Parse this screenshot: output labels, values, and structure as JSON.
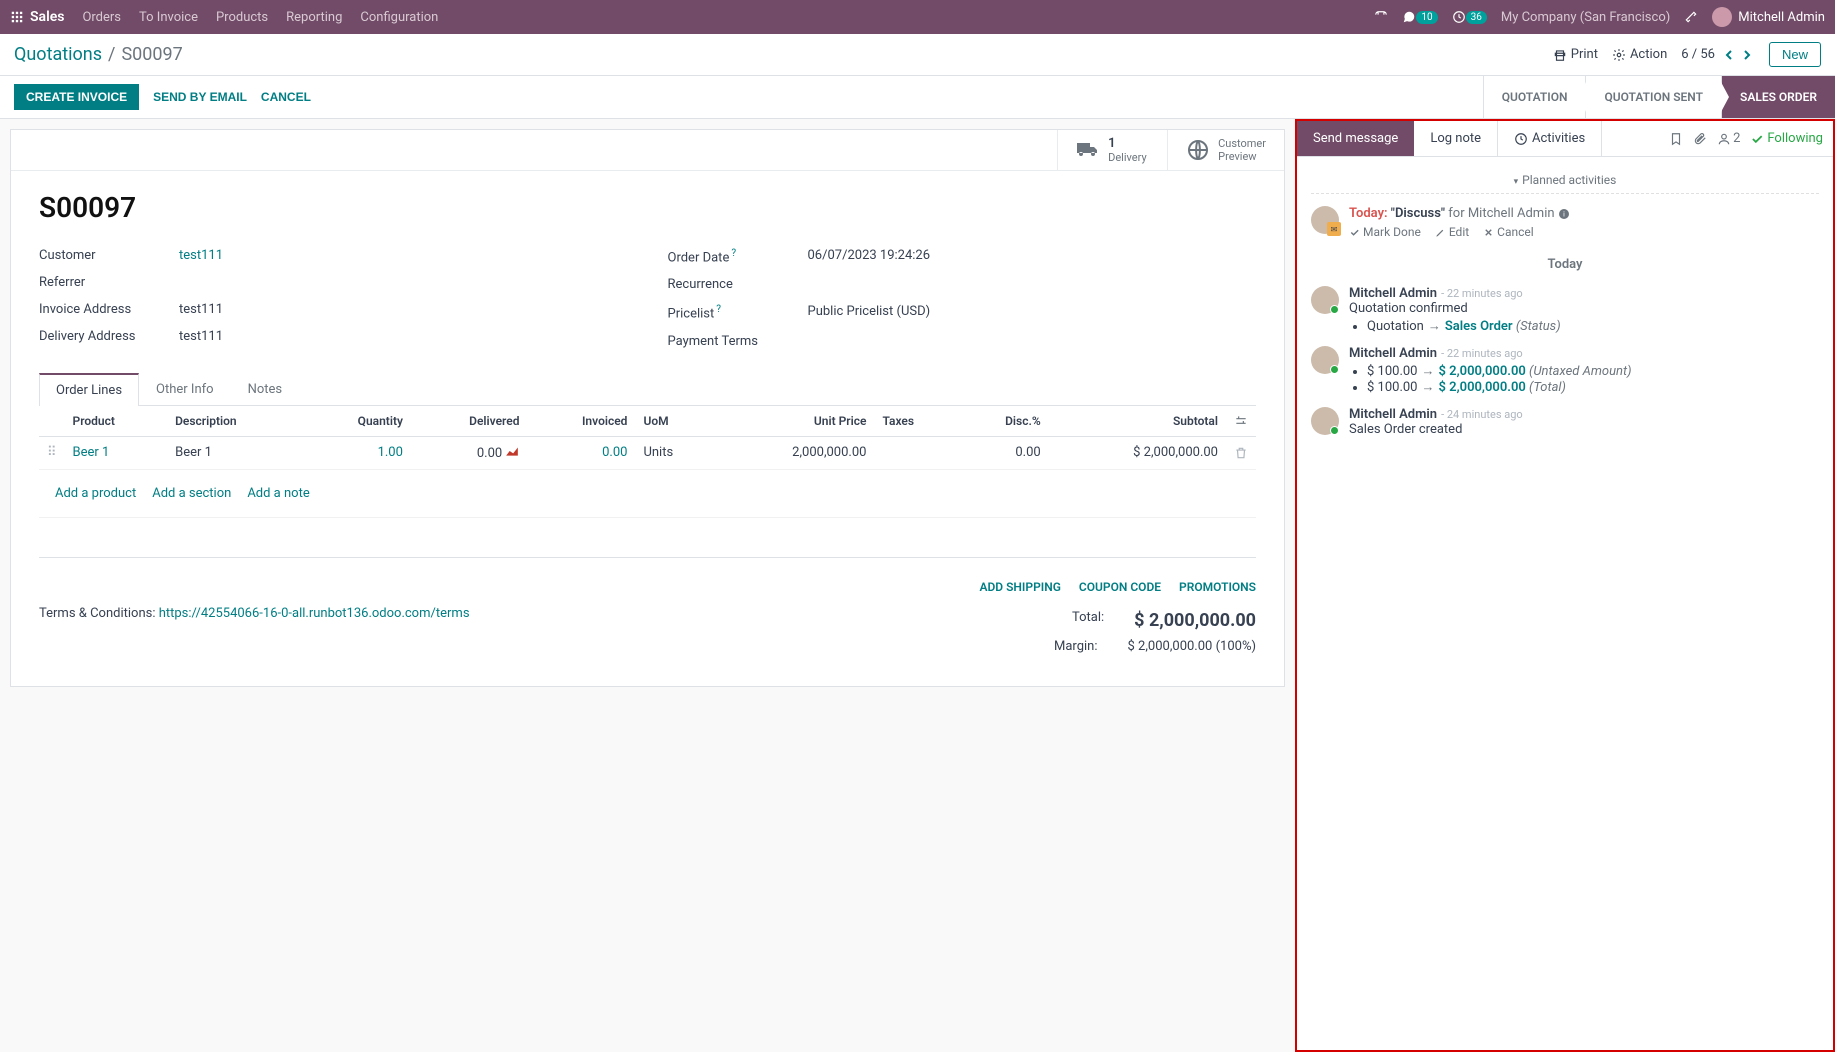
{
  "navbar": {
    "app": "Sales",
    "menus": [
      "Orders",
      "To Invoice",
      "Products",
      "Reporting",
      "Configuration"
    ],
    "messages_badge": "10",
    "activities_badge": "36",
    "company": "My Company (San Francisco)",
    "user": "Mitchell Admin"
  },
  "control_panel": {
    "parent": "Quotations",
    "current": "S00097",
    "print": "Print",
    "action": "Action",
    "pager": "6 / 56",
    "new": "New"
  },
  "action_bar": {
    "create_invoice": "CREATE INVOICE",
    "send_email": "SEND BY EMAIL",
    "cancel": "CANCEL",
    "status": {
      "quotation": "QUOTATION",
      "sent": "QUOTATION SENT",
      "order": "SALES ORDER"
    }
  },
  "stat_buttons": {
    "delivery_count": "1",
    "delivery_label": "Delivery",
    "preview_label": "Customer\nPreview"
  },
  "record": {
    "name": "S00097",
    "customer_label": "Customer",
    "customer": "test111",
    "referrer_label": "Referrer",
    "invoice_addr_label": "Invoice Address",
    "invoice_addr": "test111",
    "delivery_addr_label": "Delivery Address",
    "delivery_addr": "test111",
    "order_date_label": "Order Date",
    "order_date": "06/07/2023 19:24:26",
    "recurrence_label": "Recurrence",
    "pricelist_label": "Pricelist",
    "pricelist": "Public Pricelist (USD)",
    "payment_terms_label": "Payment Terms"
  },
  "tabs": {
    "order_lines": "Order Lines",
    "other_info": "Other Info",
    "notes": "Notes"
  },
  "table": {
    "headers": {
      "product": "Product",
      "description": "Description",
      "quantity": "Quantity",
      "delivered": "Delivered",
      "invoiced": "Invoiced",
      "uom": "UoM",
      "unit_price": "Unit Price",
      "taxes": "Taxes",
      "disc": "Disc.%",
      "subtotal": "Subtotal"
    },
    "rows": [
      {
        "product": "Beer 1",
        "description": "Beer 1",
        "quantity": "1.00",
        "delivered": "0.00",
        "invoiced": "0.00",
        "uom": "Units",
        "unit_price": "2,000,000.00",
        "taxes": "",
        "disc": "0.00",
        "subtotal": "$ 2,000,000.00"
      }
    ],
    "add_product": "Add a product",
    "add_section": "Add a section",
    "add_note": "Add a note"
  },
  "footer_links": {
    "shipping": "ADD SHIPPING",
    "coupon": "COUPON CODE",
    "promo": "PROMOTIONS"
  },
  "terms": {
    "label": "Terms & Conditions: ",
    "url": "https://42554066-16-0-all.runbot136.odoo.com/terms"
  },
  "totals": {
    "total_label": "Total:",
    "total_value": "$ 2,000,000.00",
    "margin_label": "Margin:",
    "margin_value": "$ 2,000,000.00 (100%)"
  },
  "chatter": {
    "send_message": "Send message",
    "log_note": "Log note",
    "activities": "Activities",
    "followers": "2",
    "following": "Following",
    "planned_header": "Planned activities",
    "activity": {
      "due": "Today:",
      "subject": "\"Discuss\"",
      "for": "for Mitchell Admin",
      "mark_done": "Mark Done",
      "edit": "Edit",
      "cancel": "Cancel"
    },
    "day": "Today",
    "messages": [
      {
        "author": "Mitchell Admin",
        "time": "- 22 minutes ago",
        "text": "Quotation confirmed",
        "changes": [
          {
            "field": "Quotation",
            "new": "Sales Order",
            "note": "(Status)"
          }
        ]
      },
      {
        "author": "Mitchell Admin",
        "time": "- 22 minutes ago",
        "changes": [
          {
            "old": "$ 100.00",
            "new": "$ 2,000,000.00",
            "note": "(Untaxed Amount)"
          },
          {
            "old": "$ 100.00",
            "new": "$ 2,000,000.00",
            "note": "(Total)"
          }
        ]
      },
      {
        "author": "Mitchell Admin",
        "time": "- 24 minutes ago",
        "text": "Sales Order created"
      }
    ]
  }
}
